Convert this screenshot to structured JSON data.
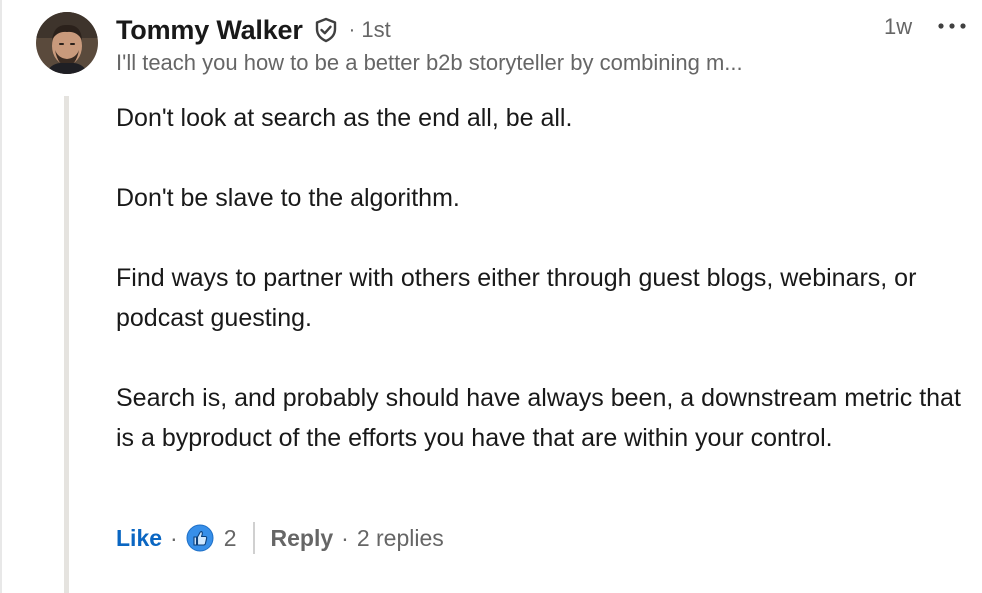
{
  "comment": {
    "author": {
      "name": "Tommy Walker",
      "degree": "1st",
      "separator": "·",
      "headline": "I'll teach you how to be a better b2b storyteller by combining m...",
      "verified_icon": "shield-check-icon"
    },
    "timestamp": "1w",
    "more_icon": "ellipsis-icon",
    "paragraphs": [
      "Don't look at search as the end all, be all.",
      "Don't be slave to the algorithm.",
      "Find ways to partner with others either through guest blogs, webinars, or podcast guesting.",
      "Search is, and probably should have always been, a downstream metric that is a byproduct of the efforts you have that are within your control."
    ],
    "actions": {
      "like_label": "Like",
      "separator": "·",
      "reaction_icon": "thumbs-up-icon",
      "like_count": "2",
      "reply_label": "Reply",
      "reply_count": "2 replies"
    }
  },
  "colors": {
    "link_blue": "#0a66c2",
    "secondary_text": "#666666",
    "primary_text": "#191919",
    "thread_line": "#e5e3df"
  }
}
